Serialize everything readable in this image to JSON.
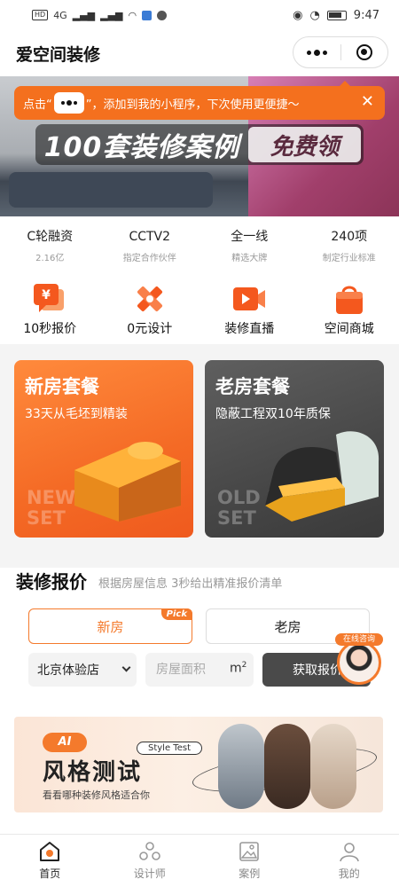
{
  "status_bar": {
    "time": "9:47",
    "network": "HD",
    "signal": "4G"
  },
  "header": {
    "title": "爱空间装修"
  },
  "banner": {
    "headline_left": "100套装修案例",
    "headline_right": "免费领"
  },
  "tip": {
    "text_before": "点击“",
    "text_after": "”，添加到我的小程序，下次使用更便捷～"
  },
  "stats": [
    {
      "value": "C轮融资",
      "label": "2.16亿"
    },
    {
      "value": "CCTV2",
      "label": "指定合作伙伴"
    },
    {
      "value": "全一线",
      "label": "精选大牌"
    },
    {
      "value": "240项",
      "label": "制定行业标准"
    }
  ],
  "quick_menu": [
    {
      "label": "10秒报价",
      "icon": "yen-quote-icon"
    },
    {
      "label": "0元设计",
      "icon": "design-tools-icon"
    },
    {
      "label": "装修直播",
      "icon": "live-video-icon"
    },
    {
      "label": "空间商城",
      "icon": "shopping-bag-icon"
    }
  ],
  "packages": {
    "new": {
      "title": "新房套餐",
      "subtitle": "33天从毛坯到精装",
      "ghost": "NEW HOUSE SET"
    },
    "old": {
      "title": "老房套餐",
      "subtitle": "隐蔽工程双10年质保",
      "ghost": "OLD HOUSE SET"
    }
  },
  "quote": {
    "title": "装修报价",
    "subtitle": "根据房屋信息 3秒给出精准报价清单",
    "tab_new": "新房",
    "tab_old": "老房",
    "pick_badge": "Pick",
    "store": "北京体验店",
    "area_placeholder": "房屋面积",
    "unit": "m",
    "unit_sup": "2",
    "submit": "获取报价",
    "consult_label": "在线咨询"
  },
  "ai_banner": {
    "tag": "AI",
    "title": "风格测试",
    "style_test": "Style Test",
    "subtitle": "看看哪种装修风格适合你"
  },
  "tabbar": [
    {
      "label": "首页",
      "active": true
    },
    {
      "label": "设计师",
      "active": false
    },
    {
      "label": "案例",
      "active": false
    },
    {
      "label": "我的",
      "active": false
    }
  ],
  "colors": {
    "accent": "#f47a2c",
    "tip": "#f4701e",
    "dark_card": "#474747"
  }
}
